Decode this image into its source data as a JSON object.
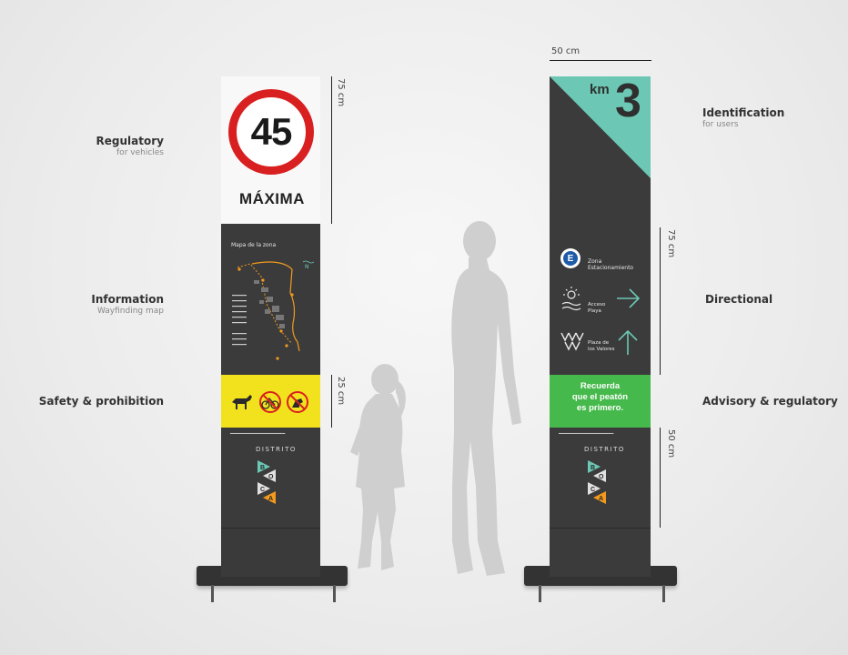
{
  "labels": {
    "regulatory": {
      "title": "Regulatory",
      "sub": "for vehicles"
    },
    "information": {
      "title": "Information",
      "sub": "Wayfinding map"
    },
    "safety": {
      "title": "Safety & prohibition"
    },
    "identification": {
      "title": "Identification",
      "sub": "for users"
    },
    "directional": {
      "title": "Directional"
    },
    "advisory": {
      "title": "Advisory & regulatory"
    }
  },
  "dimensions": {
    "width_top": "50 cm",
    "left_top": "75 cm",
    "left_mid": "25 cm",
    "right_mid": "75 cm",
    "right_bottom": "50 cm"
  },
  "left_totem": {
    "speed_value": "45",
    "speed_word": "MÁXIMA",
    "map_title": "Mapa de la zona",
    "north": "N",
    "district_label": "DISTRITO",
    "district_letters": [
      "B",
      "O",
      "C",
      "A"
    ]
  },
  "right_totem": {
    "km_label": "km",
    "km_value": "3",
    "zone_letter": "E",
    "zone_text": [
      "Zona",
      "Estacionamiento"
    ],
    "access_text": [
      "Acceso",
      "Playa"
    ],
    "plaza_text": [
      "Plaza de",
      "los Valores"
    ],
    "advisory_lines": [
      "Recuerda",
      "que el peatón",
      "es primero."
    ],
    "district_label": "DISTRITO",
    "district_letters": [
      "B",
      "O",
      "C",
      "A"
    ]
  },
  "colors": {
    "accent_teal": "#6cc8b5",
    "speed_red": "#d92020",
    "advisory_green": "#45b94b",
    "safety_yellow": "#f2e21d",
    "totem_dark": "#3b3b3b",
    "accent_orange": "#f39a1e"
  }
}
